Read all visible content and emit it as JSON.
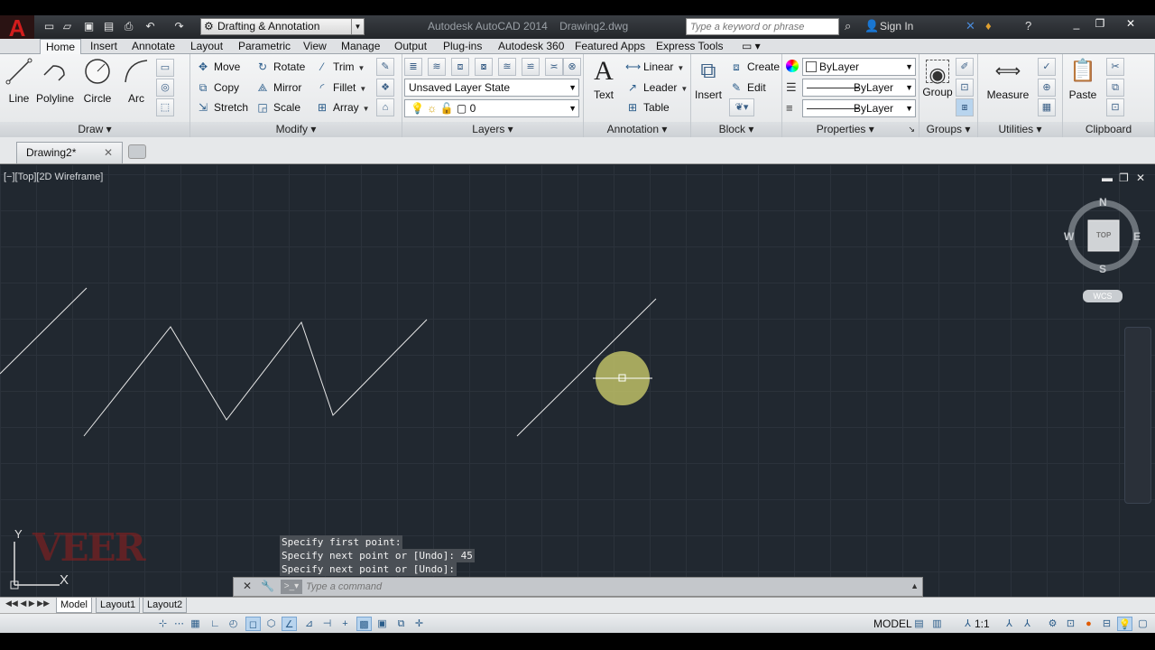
{
  "title_bar": {
    "logo": "A",
    "workspace": "Drafting & Annotation",
    "app_title": "Autodesk AutoCAD 2014    Drawing2.dwg",
    "search_placeholder": "Type a keyword or phrase",
    "sign_in": "Sign In"
  },
  "ribbon_tabs": [
    "Home",
    "Insert",
    "Annotate",
    "Layout",
    "Parametric",
    "View",
    "Manage",
    "Output",
    "Plug-ins",
    "Autodesk 360",
    "Featured Apps",
    "Express Tools"
  ],
  "draw": {
    "title": "Draw",
    "line": "Line",
    "polyline": "Polyline",
    "circle": "Circle",
    "arc": "Arc"
  },
  "modify": {
    "title": "Modify",
    "move": "Move",
    "rotate": "Rotate",
    "trim": "Trim",
    "copy": "Copy",
    "mirror": "Mirror",
    "fillet": "Fillet",
    "stretch": "Stretch",
    "scale": "Scale",
    "array": "Array"
  },
  "layers": {
    "title": "Layers",
    "layer_state": "Unsaved Layer State",
    "current_layer": "0"
  },
  "annotation": {
    "title": "Annotation",
    "text": "Text",
    "linear": "Linear",
    "leader": "Leader",
    "table": "Table"
  },
  "block": {
    "title": "Block",
    "insert": "Insert",
    "create": "Create",
    "edit": "Edit"
  },
  "properties": {
    "title": "Properties",
    "color": "ByLayer",
    "linetype": "ByLayer",
    "lineweight": "ByLayer"
  },
  "groups": {
    "title": "Groups",
    "group": "Group"
  },
  "utilities": {
    "title": "Utilities",
    "measure": "Measure"
  },
  "clipboard": {
    "title": "Clipboard",
    "paste": "Paste"
  },
  "document": {
    "tab": "Drawing2*"
  },
  "viewport": {
    "label": "[−][Top][2D Wireframe]"
  },
  "viewcube": {
    "n": "N",
    "s": "S",
    "e": "E",
    "w": "W",
    "face": "TOP",
    "wcs": "WCS"
  },
  "ucs": {
    "x": "X",
    "y": "Y"
  },
  "watermark": "VEER",
  "command": {
    "history": [
      "Specify first point:",
      "Specify next point or [Undo]: 45",
      "Specify next point or [Undo]:"
    ],
    "placeholder": "Type a command"
  },
  "layout_tabs": [
    "Model",
    "Layout1",
    "Layout2"
  ],
  "status": {
    "model": "MODEL",
    "scale": "1:1"
  },
  "colors": {
    "canvas": "#212830",
    "line": "#e8e8e8",
    "cursor_highlight": "#c8c86a",
    "logo_red": "#d21d1d"
  }
}
